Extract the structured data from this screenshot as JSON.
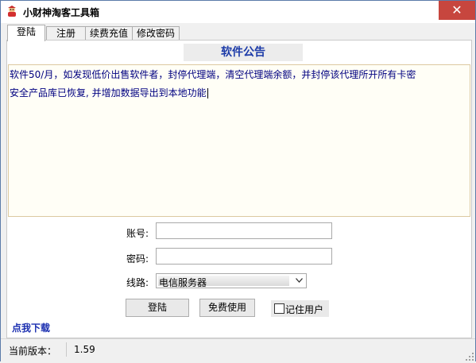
{
  "window": {
    "title": "小财神淘客工具箱",
    "close_symbol": "✕"
  },
  "tabs": [
    {
      "label": "登陆",
      "active": true
    },
    {
      "label": "注册",
      "active": false
    },
    {
      "label": "续费充值",
      "active": false
    },
    {
      "label": "修改密码",
      "active": false
    }
  ],
  "notice": {
    "title": "软件公告",
    "lines": [
      "软件50/月，如发现低价出售软件者，封停代理端，清空代理端余额，并封停该代理所开所有卡密",
      "安全产品库已恢复, 并增加数据导出到本地功能"
    ]
  },
  "form": {
    "account_label": "账号:",
    "account_value": "",
    "password_label": "密码:",
    "password_value": "",
    "line_label": "线路:",
    "line_selected": "电信服务器"
  },
  "buttons": {
    "login": "登陆",
    "free_use": "免费使用",
    "remember_label": "记住用户",
    "remember_checked": false
  },
  "download_link": "点我下载",
  "status": {
    "version_label": "当前版本：",
    "version_value": "1.59"
  },
  "colors": {
    "accent_blue": "#1b3aa8",
    "close_red": "#c7463e",
    "notice_bg": "#fffef6"
  },
  "icons": {
    "app": "god-of-wealth-icon",
    "dropdown": "chevron-down-icon",
    "grip": "resize-grip-icon"
  }
}
